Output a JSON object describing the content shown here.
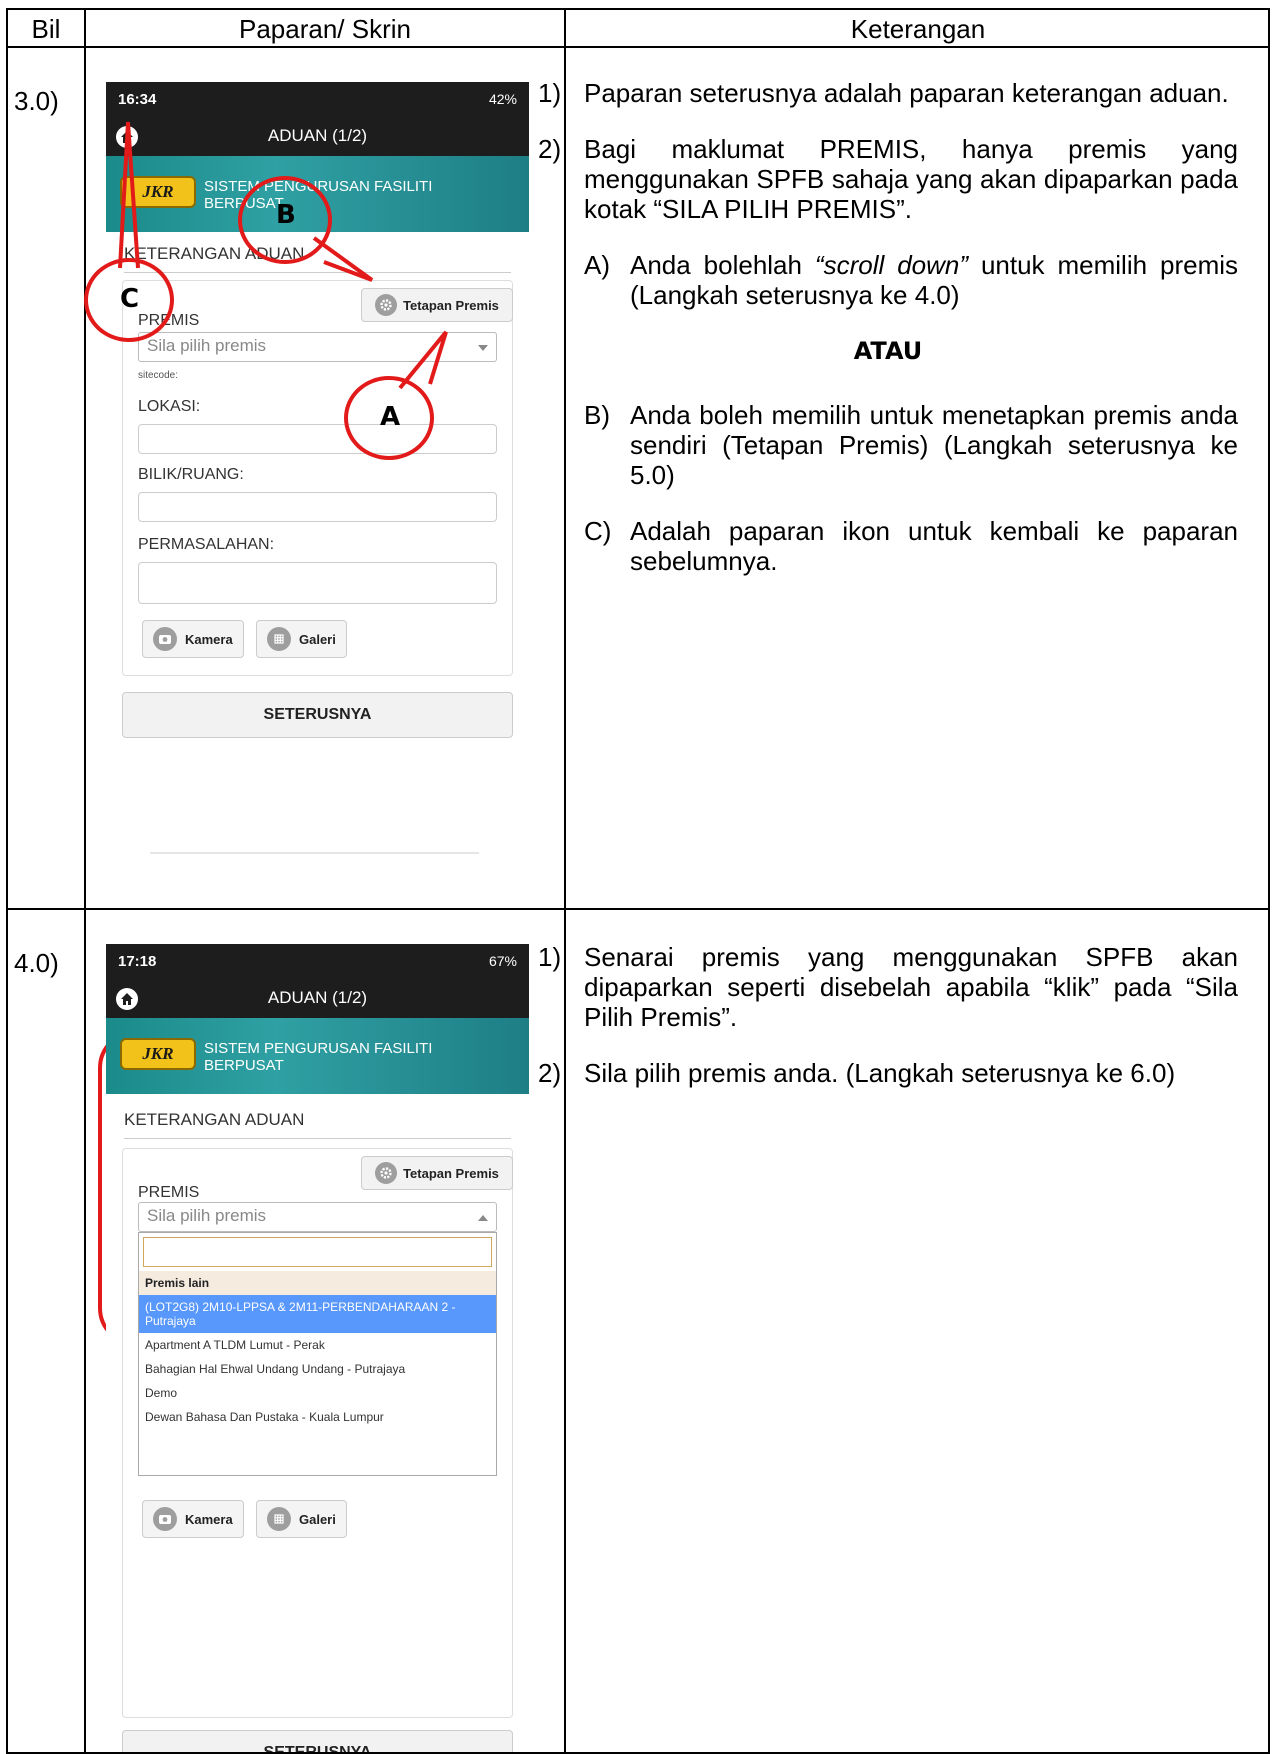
{
  "header": {
    "bil": "Bil",
    "paparan": "Paparan/ Skrin",
    "keterangan": "Keterangan"
  },
  "rows": [
    {
      "bil": "3.0)",
      "screen": {
        "status_left": "16:34",
        "status_right": "42%",
        "title": "ADUAN (1/2)",
        "banner_logo": "JKR",
        "banner_line1": "SISTEM PENGURUSAN FASILITI",
        "banner_line2": "BERPUSAT",
        "section": "KETERANGAN ADUAN",
        "tetapan": "Tetapan Premis",
        "premis_label": "PREMIS",
        "premis_placeholder": "Sila pilih premis",
        "sitecode": "sitecode:",
        "lokasi": "LOKASI:",
        "bilik": "BILIK/RUANG:",
        "permasalahan": "PERMASALAHAN:",
        "kamera": "Kamera",
        "galeri": "Galeri",
        "next": "SETERUSNYA"
      },
      "annotations": {
        "a": "A",
        "b": "B",
        "c": "C"
      },
      "items": [
        {
          "num": "1)",
          "text": "Paparan seterusnya adalah paparan keterangan aduan."
        },
        {
          "num": "2)",
          "text": "Bagi maklumat PREMIS, hanya premis yang menggunakan SPFB sahaja yang akan dipaparkan pada kotak “SILA PILIH PREMIS”."
        }
      ],
      "sub_a": {
        "num": "A)",
        "pre": "Anda bolehlah ",
        "em": "“scroll down”",
        "post": " untuk memilih premis (Langkah seterusnya ke 4.0)"
      },
      "atau": "ATAU",
      "sub_b": {
        "num": "B)",
        "text": "Anda boleh memilih untuk menetapkan premis anda sendiri (Tetapan Premis) (Langkah seterusnya ke 5.0)"
      },
      "sub_c": {
        "num": "C)",
        "text": "Adalah paparan ikon untuk kembali ke paparan sebelumnya."
      }
    },
    {
      "bil": "4.0)",
      "screen": {
        "status_left": "17:18",
        "status_right": "67%",
        "title": "ADUAN (1/2)",
        "banner_logo": "JKR",
        "banner_line1": "SISTEM PENGURUSAN FASILITI",
        "banner_line2": "BERPUSAT",
        "section": "KETERANGAN ADUAN",
        "tetapan": "Tetapan Premis",
        "premis_label": "PREMIS",
        "premis_placeholder": "Sila pilih premis",
        "group": "Premis lain",
        "options": [
          "(LOT2G8) 2M10-LPPSA & 2M11-PERBENDAHARAAN 2 - Putrajaya",
          "Apartment A TLDM Lumut - Perak",
          "Bahagian Hal Ehwal Undang Undang - Putrajaya",
          "Demo",
          "Dewan Bahasa Dan Pustaka - Kuala Lumpur"
        ],
        "kamera": "Kamera",
        "galeri": "Galeri",
        "next": "SETERUSNYA"
      },
      "items": [
        {
          "num": "1)",
          "text": "Senarai premis yang menggunakan SPFB akan dipaparkan seperti disebelah apabila “klik” pada “Sila Pilih Premis”."
        },
        {
          "num": "2)",
          "text": "Sila pilih premis anda. (Langkah seterusnya ke 6.0)"
        }
      ]
    }
  ]
}
